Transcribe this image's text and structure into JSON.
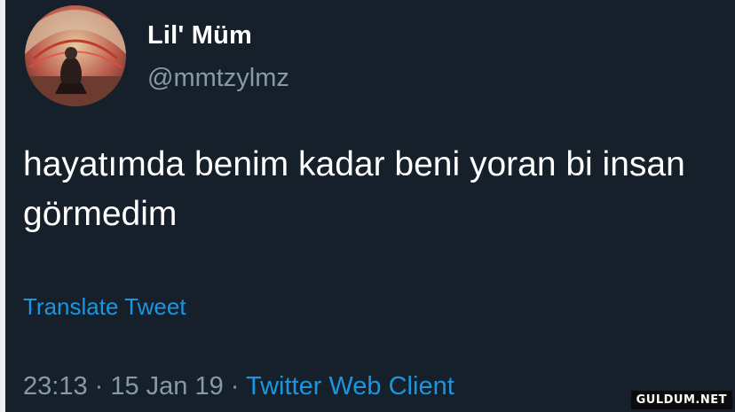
{
  "user": {
    "display_name": "Lil' Müm",
    "handle": "@mmtzylmz",
    "avatar_icon": "profile-photo-avatar"
  },
  "tweet": {
    "text": "hayatımda benim kadar beni yoran bi insan görmedim",
    "translate_label": "Translate Tweet",
    "time": "23:13",
    "separator": " · ",
    "date": "15 Jan 19",
    "source": "Twitter Web Client"
  },
  "watermark": "GULDUM.NET",
  "colors": {
    "background": "#15202b",
    "text_primary": "#ffffff",
    "text_secondary": "#8899a6",
    "link": "#1b95e0"
  }
}
